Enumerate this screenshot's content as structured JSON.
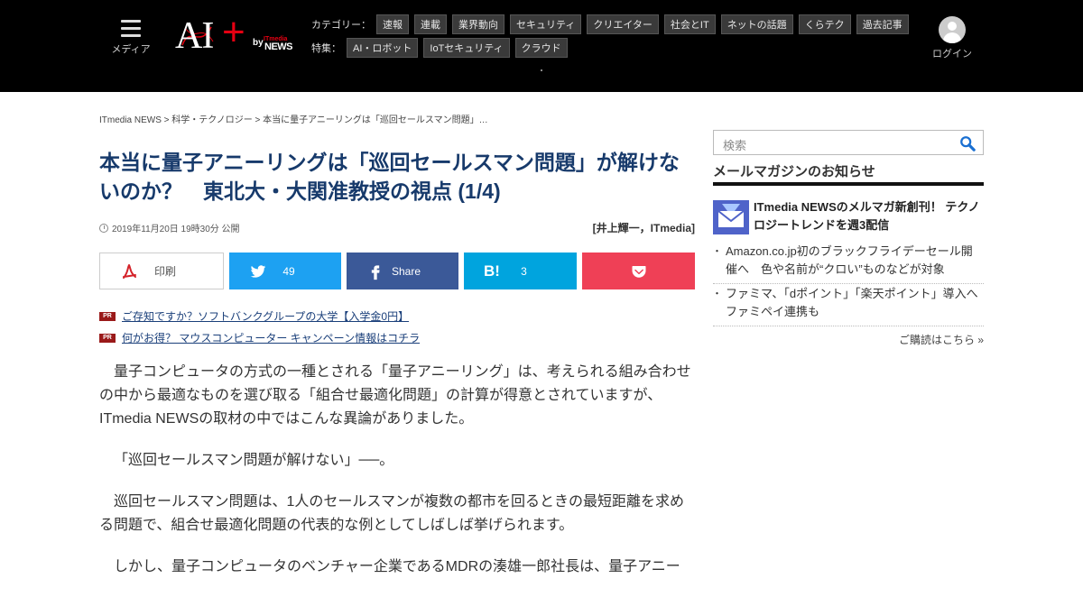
{
  "header": {
    "menu_label": "メディア",
    "logo": {
      "ai": "AI",
      "plus": "+",
      "by": "by",
      "itmedia": "ITmedia",
      "news": "NEWS"
    },
    "categories_label": "カテゴリー：",
    "categories": [
      "速報",
      "連載",
      "業界動向",
      "セキュリティ",
      "クリエイター",
      "社会とIT",
      "ネットの話題",
      "くらテク",
      "過去記事"
    ],
    "features_label": "特集：",
    "features": [
      "AI・ロボット",
      "IoTセキュリティ",
      "クラウド"
    ],
    "login_label": "ログイン"
  },
  "breadcrumb": "ITmedia NEWS > 科学・テクノロジー > 本当に量子アニーリングは「巡回セールスマン問題」…",
  "article": {
    "title": "本当に量子アニーリングは「巡回セールスマン問題」が解けないのか？　東北大・大関准教授の視点 (1/4)",
    "date": "2019年11月20日 19時30分 公開",
    "author": "[井上輝一，ITmedia]",
    "paragraphs": [
      "量子コンピュータの方式の一種とされる「量子アニーリング」は、考えられる組み合わせの中から最適なものを選び取る「組合せ最適化問題」の計算が得意とされていますが、ITmedia NEWSの取材の中ではこんな異論がありました。",
      "「巡回セールスマン問題が解けない」──。",
      "巡回セールスマン問題は、1人のセールスマンが複数の都市を回るときの最短距離を求める問題で、組合せ最適化問題の代表的な例としてしばしば挙げられます。",
      "しかし、量子コンピュータのベンチャー企業であるMDRの湊雄一郎社長は、量子アニー"
    ]
  },
  "share": {
    "print_label": "印刷",
    "twitter_count": "49",
    "facebook_label": "Share",
    "hatena_count": "3",
    "hatena_icon_text": "B!"
  },
  "pr": {
    "badge": "PR",
    "links": [
      "ご存知ですか？ソフトバンクグループの大学【入学金0円】",
      "何がお得？ マウスコンピューター キャンペーン情報はコチラ"
    ]
  },
  "sidebar": {
    "search_placeholder": "検索",
    "mail_heading": "メールマガジンのお知らせ",
    "mail_feature": "ITmedia NEWSのメルマガ新創刊！ テクノロジートレンドを週3配信",
    "news": [
      "Amazon.co.jp初のブラックフライデーセール開催へ　色や名前が“クロい”ものなどが対象",
      "ファミマ、「dポイント」「楽天ポイント」導入へ　ファミペイ連携も"
    ],
    "more_label": "ご購読はこちら »"
  },
  "colors": {
    "header_bg": "#000000",
    "title": "#173a6b",
    "twitter": "#1da1f2",
    "facebook": "#3b5998",
    "hatena": "#00a4de",
    "pocket": "#ef4056",
    "logo_accent": "#e60012"
  }
}
